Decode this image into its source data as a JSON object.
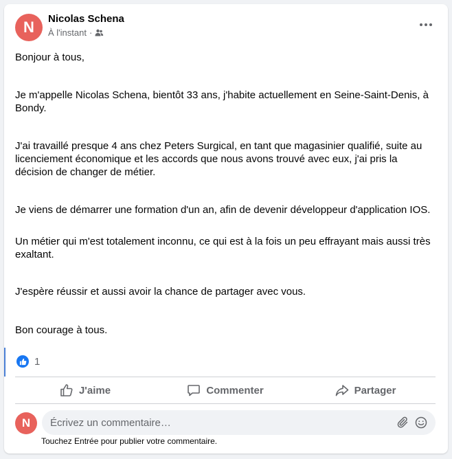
{
  "post": {
    "author": "Nicolas Schena",
    "avatar_initial": "N",
    "timestamp": "À l'instant",
    "separator": "·",
    "audience_icon": "friends-icon",
    "paragraphs": [
      "Bonjour à tous,",
      "Je m'appelle Nicolas Schena, bientôt 33 ans, j'habite actuellement en Seine-Saint-Denis, à Bondy.",
      "J'ai travaillé presque 4 ans chez Peters Surgical, en tant que magasinier qualifié, suite au licenciement économique et les accords que nous avons trouvé avec eux, j'ai pris la décision de changer de métier.",
      "Je viens de démarrer une formation d'un an, afin de devenir développeur d'application IOS.",
      "Un métier qui m'est totalement inconnu, ce qui est à la fois un peu effrayant mais aussi très exaltant.",
      "J'espère réussir et aussi avoir la chance de partager avec vous.",
      "Bon courage à tous."
    ]
  },
  "reactions": {
    "count": "1",
    "icon": "like-reaction-icon"
  },
  "actions": {
    "like": "J'aime",
    "comment": "Commenter",
    "share": "Partager"
  },
  "comment": {
    "avatar_initial": "N",
    "placeholder": "Écrivez un commentaire…",
    "value": "",
    "hint": "Touchez Entrée pour publier votre commentaire."
  },
  "colors": {
    "accent": "#1877f2",
    "avatar": "#e8625c",
    "secondary_text": "#65676b"
  }
}
